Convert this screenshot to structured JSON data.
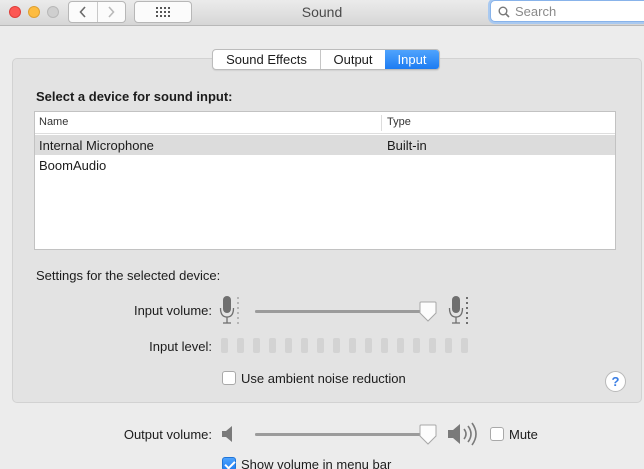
{
  "window": {
    "title": "Sound"
  },
  "search": {
    "placeholder": "Search"
  },
  "tabs": [
    {
      "label": "Sound Effects",
      "active": false
    },
    {
      "label": "Output",
      "active": false
    },
    {
      "label": "Input",
      "active": true
    }
  ],
  "input": {
    "heading": "Select a device for sound input:",
    "columns": [
      "Name",
      "Type"
    ],
    "devices": [
      {
        "name": "Internal Microphone",
        "type": "Built-in",
        "selected": true
      },
      {
        "name": "BoomAudio",
        "type": "",
        "selected": false
      }
    ],
    "settings_label": "Settings for the selected device:",
    "input_volume_label": "Input volume:",
    "input_volume": 0.98,
    "input_level_label": "Input level:",
    "input_level_lit": 0,
    "ambient_noise_label": "Use ambient noise reduction",
    "ambient_noise_checked": false,
    "help": "?"
  },
  "output": {
    "volume_label": "Output volume:",
    "volume": 0.98,
    "mute_label": "Mute",
    "mute_checked": false,
    "menubar_label": "Show volume in menu bar",
    "menubar_checked": true
  },
  "icons": {
    "back": "chevron-left-icon",
    "forward": "chevron-right-icon",
    "grid": "grid-icon",
    "search": "search-icon",
    "mic_low": "microphone-low-icon",
    "mic_high": "microphone-high-icon",
    "speaker_low": "speaker-low-icon",
    "speaker_high": "speaker-high-icon"
  },
  "colors": {
    "accent": "#1d7cf2",
    "close": "#fc5753",
    "minimize": "#fdbc40",
    "help": "#3a7ee4"
  }
}
